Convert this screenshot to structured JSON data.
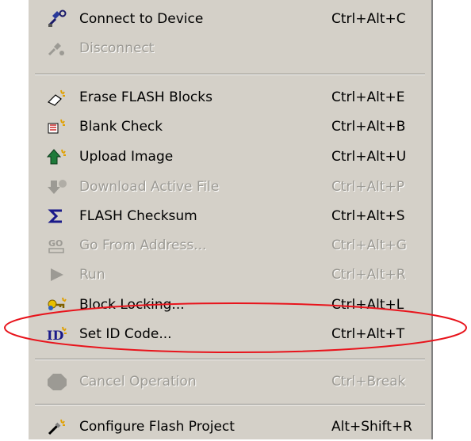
{
  "menu": {
    "items": [
      {
        "label": "Connect to Device",
        "shortcut": "Ctrl+Alt+C",
        "enabled": true
      },
      {
        "label": "Disconnect",
        "shortcut": "",
        "enabled": false
      },
      {
        "label": "Erase FLASH Blocks",
        "shortcut": "Ctrl+Alt+E",
        "enabled": true
      },
      {
        "label": "Blank Check",
        "shortcut": "Ctrl+Alt+B",
        "enabled": true
      },
      {
        "label": "Upload Image",
        "shortcut": "Ctrl+Alt+U",
        "enabled": true
      },
      {
        "label": "Download Active File",
        "shortcut": "Ctrl+Alt+P",
        "enabled": false
      },
      {
        "label": "FLASH Checksum",
        "shortcut": "Ctrl+Alt+S",
        "enabled": true
      },
      {
        "label": "Go From Address...",
        "shortcut": "Ctrl+Alt+G",
        "enabled": false
      },
      {
        "label": "Run",
        "shortcut": "Ctrl+Alt+R",
        "enabled": false
      },
      {
        "label": "Block Locking...",
        "shortcut": "Ctrl+Alt+L",
        "enabled": true
      },
      {
        "label": "Set ID Code...",
        "shortcut": "Ctrl+Alt+T",
        "enabled": true
      },
      {
        "label": "Cancel Operation",
        "shortcut": "Ctrl+Break",
        "enabled": false
      },
      {
        "label": "Configure Flash Project",
        "shortcut": "Alt+Shift+R",
        "enabled": true
      }
    ],
    "icons": [
      "connect-icon",
      "disconnect-icon",
      "erase-icon",
      "blank-check-icon",
      "upload-icon",
      "download-icon",
      "sigma-icon",
      "go-address-icon",
      "run-icon",
      "key-icon",
      "id-icon",
      "stop-icon",
      "configure-icon"
    ]
  },
  "colors": {
    "menu_background": "#d4d0c8",
    "disabled_text": "#9c9a94",
    "highlight_ellipse": "#e8141c"
  }
}
